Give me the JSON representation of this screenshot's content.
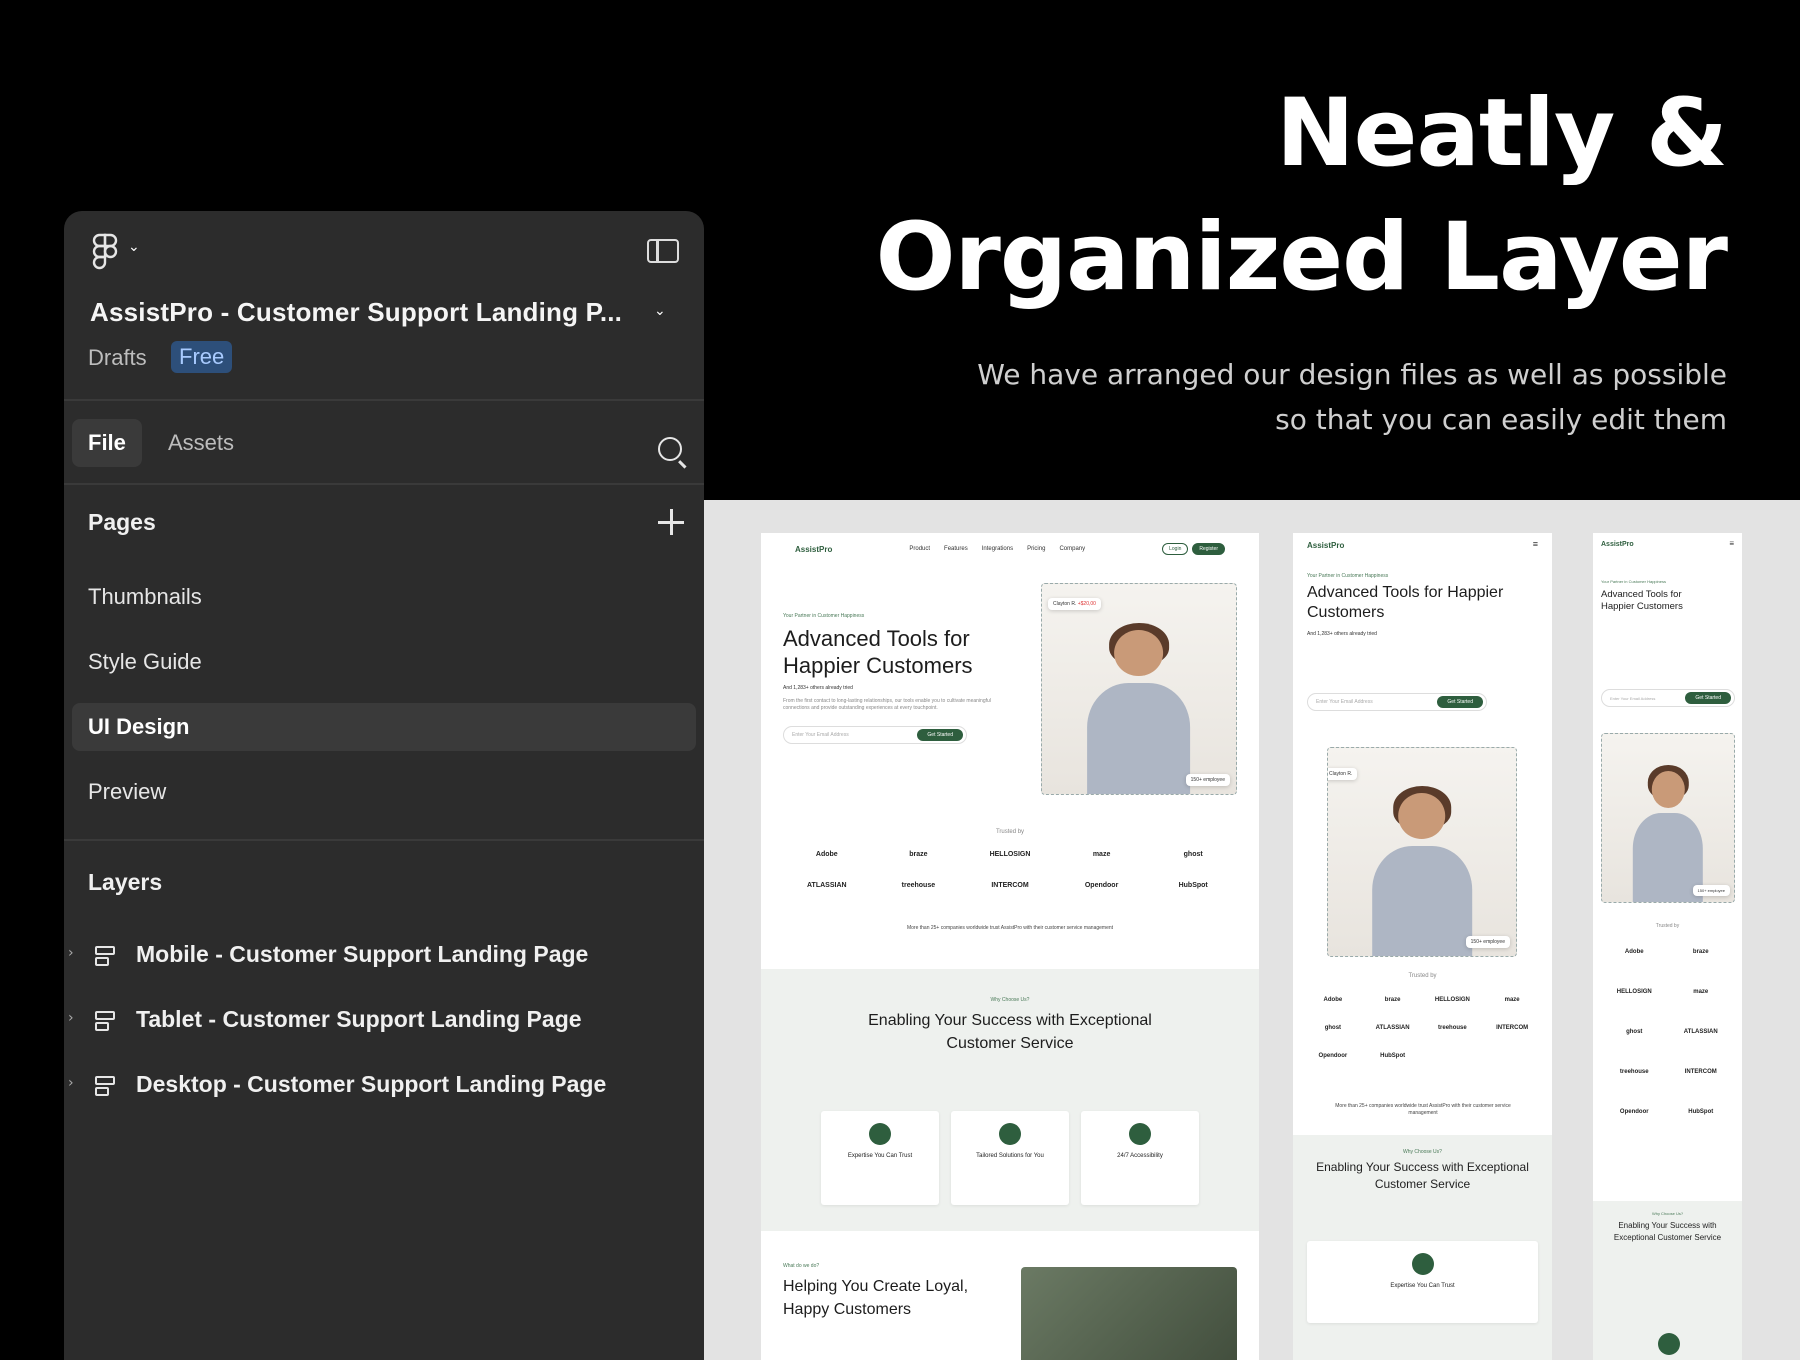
{
  "headline": {
    "line1": "Neatly &",
    "line2": "Organized Layer",
    "sub1": "We have arranged our design files as well as possible",
    "sub2": "so that you can easily edit them"
  },
  "panel": {
    "file_title": "AssistPro - Customer Support Landing P...",
    "drafts": "Drafts",
    "plan_badge": "Free",
    "tabs": [
      {
        "label": "File"
      },
      {
        "label": "Assets"
      }
    ],
    "pages_heading": "Pages",
    "pages": [
      {
        "label": "Thumbnails"
      },
      {
        "label": "Style Guide"
      },
      {
        "label": "UI Design"
      },
      {
        "label": "Preview"
      }
    ],
    "layers_heading": "Layers",
    "layers": [
      {
        "label": "Mobile - Customer Support Landing Page"
      },
      {
        "label": "Tablet - Customer Support Landing Page"
      },
      {
        "label": "Desktop - Customer Support Landing Page"
      }
    ]
  },
  "preview": {
    "logo": "AssistPro",
    "nav": [
      "Product",
      "Features",
      "Integrations",
      "Pricing",
      "Company"
    ],
    "login": "Login",
    "register": "Register",
    "tagline": "Your Partner in Customer Happiness",
    "hero_title_1": "Advanced Tools for",
    "hero_title_2": "Happier Customers",
    "social_proof": "And 1,283+ others already tried",
    "hero_text": "From the first contact to long-lasting relationships, our tools enable you to cultivate meaningful connections and provide outstanding experiences at every touchpoint.",
    "email_placeholder": "Enter Your Email Address",
    "cta": "Get Started",
    "card_name": "Clayton R.",
    "card_amount": "+$20,00",
    "employee_badge": "150+ employee",
    "trusted_by": "Trusted by",
    "logos": [
      "Adobe",
      "braze",
      "HELLOSIGN",
      "maze",
      "ghost",
      "ATLASSIAN",
      "treehouse",
      "INTERCOM",
      "Opendoor",
      "HubSpot"
    ],
    "companies_text": "More than 25+ companies worldwide trust AssistPro with their customer service management",
    "why_label": "Why Choose Us?",
    "why_title_1": "Enabling Your Success with Exceptional",
    "why_title_2": "Customer Service",
    "features": [
      {
        "title": "Expertise You Can Trust"
      },
      {
        "title": "Tailored Solutions for You"
      },
      {
        "title": "24/7 Accessibility"
      }
    ],
    "what_label": "What do we do?",
    "helping_title_1": "Helping You Create Loyal,",
    "helping_title_2": "Happy Customers"
  },
  "colors": {
    "accent": "#2e5e3e",
    "panel_bg": "#2c2c2c",
    "badge_bg": "#2d4f7a"
  }
}
